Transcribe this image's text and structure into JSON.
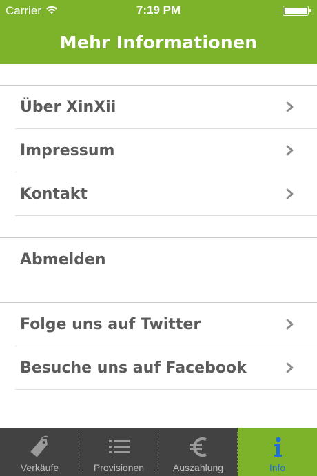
{
  "status_bar": {
    "carrier": "Carrier",
    "time": "7:19 PM"
  },
  "nav": {
    "title": "Mehr Informationen"
  },
  "groups": [
    {
      "items": [
        {
          "label": "Über XinXii",
          "icon": "chevron-right-icon"
        },
        {
          "label": "Impressum",
          "icon": "chevron-right-icon"
        },
        {
          "label": "Kontakt",
          "icon": "chevron-right-icon"
        }
      ]
    },
    {
      "items": [
        {
          "label": "Abmelden"
        }
      ]
    },
    {
      "items": [
        {
          "label": "Folge uns auf Twitter",
          "icon": "chevron-right-icon"
        },
        {
          "label": "Besuche uns auf Facebook",
          "icon": "chevron-right-icon"
        }
      ]
    }
  ],
  "tabbar": {
    "tabs": [
      {
        "label": "Verkäufe",
        "icon": "price-tag-icon"
      },
      {
        "label": "Provisionen",
        "icon": "list-icon"
      },
      {
        "label": "Auszahlung",
        "icon": "euro-icon"
      },
      {
        "label": "Info",
        "icon": "info-icon",
        "active": true
      }
    ]
  },
  "colors": {
    "brand_green": "#7db32a",
    "tabbar_bg": "#424242",
    "active_icon_blue": "#1e6fd9",
    "row_text": "#5b5b5b"
  }
}
